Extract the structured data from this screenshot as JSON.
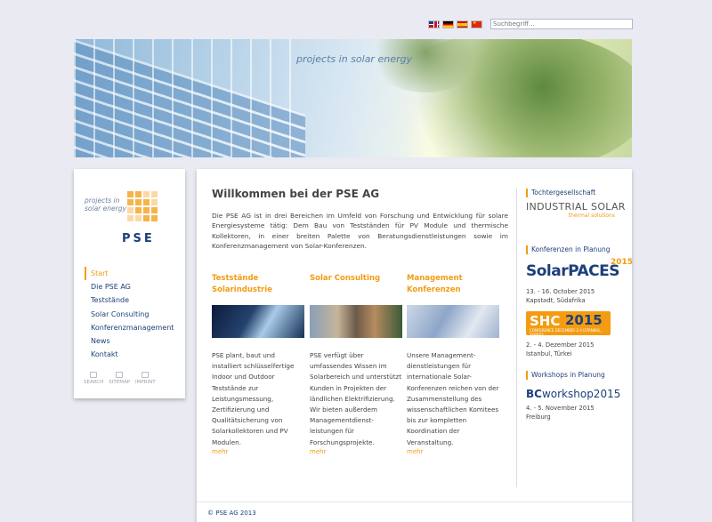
{
  "header": {
    "languages": [
      "en",
      "de",
      "es",
      "cn"
    ],
    "search_placeholder": "Suchbegriff..."
  },
  "banner": {
    "tagline": "projects in solar energy"
  },
  "logo": {
    "tagline": "projects in\nsolar energy",
    "name": "PSE"
  },
  "nav": {
    "items": [
      "Start",
      "Die PSE AG",
      "Teststände",
      "Solar Consulting",
      "Konferenzmanagement",
      "News",
      "Kontakt"
    ],
    "active": "Start"
  },
  "tools": [
    "SEARCH",
    "SITEMAP",
    "IMPRINT"
  ],
  "main": {
    "title": "Willkommen bei der PSE AG",
    "intro": "Die PSE AG ist in drei Bereichen im Umfeld von Forschung und Entwicklung für solare Energiesysteme tätig: Dem Bau von Testständen für PV Module und thermische Kollektoren, in einer breiten Palette von Beratungsdienstleistungen sowie im Konferenzmanagement von Solar-Konferenzen.",
    "columns": [
      {
        "title": "Teststände Solarindustrie",
        "text": "PSE plant, baut und installiert schlüsselfertige Indoor und Outdoor Teststände zur Leistungsmessung, Zertifizierung und Qualitätsicherung von Solarkollektoren und PV Modulen.",
        "more": "mehr"
      },
      {
        "title": "Solar Consulting",
        "text": "PSE verfügt über umfassendes Wissen im Solarbereich und unterstützt Kunden in Projekten der ländlichen Elektrifizierung. Wir bieten außerdem Managementdienst-leistungen für Forschungsprojekte.",
        "more": "mehr"
      },
      {
        "title": "Management Konferenzen",
        "text": "Unsere Management-dienstleistungen für internationale Solar-Konferenzen reichen von der Zusammenstellung des wissenschaftlichen Komitees bis zur kompletten Koordination der Veranstaltung.",
        "more": "mehr"
      }
    ],
    "footer": "© PSE AG 2013"
  },
  "sidebar": {
    "subsidiary": {
      "heading": "Tochtergesellschaft",
      "logo_line1": "INDUSTRIAL SOLAR",
      "logo_line2": "thermal solutions"
    },
    "conferences": {
      "heading": "Konferenzen in Planung",
      "items": [
        {
          "logo": "SolarPACES",
          "year": "2015",
          "date": "13. - 16. October 2015",
          "place": "Kapstadt, Südafrika"
        },
        {
          "logo_a": "SHC",
          "logo_b": "2015",
          "logo_c": "CONFERENCE  DECEMBER 2-4  ISTANBUL, TURKEY",
          "date": "2. - 4. Dezember 2015",
          "place": "Istanbul, Türkei"
        }
      ]
    },
    "workshops": {
      "heading": "Workshops in Planung",
      "logo_a": "BC",
      "logo_b": "workshop2015",
      "date": "4. - 5.  November 2015",
      "place": "Freiburg"
    }
  }
}
